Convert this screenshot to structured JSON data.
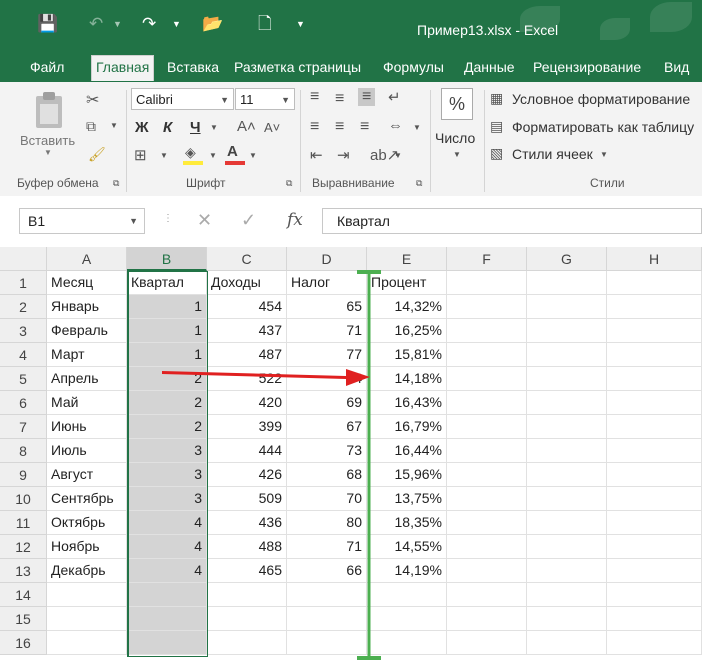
{
  "window": {
    "title": "Пример13.xlsx - Excel",
    "theme_color": "#217346"
  },
  "ribbon_tabs": [
    "Файл",
    "Главная",
    "Вставка",
    "Разметка страницы",
    "Формулы",
    "Данные",
    "Рецензирование",
    "Вид"
  ],
  "ribbon": {
    "clipboard": {
      "paste_label": "Вставить",
      "group_label": "Буфер обмена"
    },
    "font": {
      "font_name": "Calibri",
      "font_size": "11",
      "bold": "Ж",
      "italic": "К",
      "underline": "Ч",
      "group_label": "Шрифт"
    },
    "alignment": {
      "group_label": "Выравнивание"
    },
    "number": {
      "percent_symbol": "%",
      "label": "Число"
    },
    "styles": {
      "items": [
        "Условное форматирование",
        "Форматировать как таблицу",
        "Стили ячеек"
      ],
      "group_label": "Стили"
    }
  },
  "formula_bar": {
    "name_box": "B1",
    "fx_label": "fx",
    "content": "Квартал"
  },
  "sheet": {
    "columns": [
      "A",
      "B",
      "C",
      "D",
      "E",
      "F",
      "G",
      "H"
    ],
    "selected_column": "B",
    "row_numbers": [
      "1",
      "2",
      "3",
      "4",
      "5",
      "6",
      "7",
      "8",
      "9",
      "10",
      "11",
      "12",
      "13",
      "14",
      "15",
      "16"
    ],
    "headers": [
      "Месяц",
      "Квартал",
      "Доходы",
      "Налог",
      "Процент"
    ],
    "rows": [
      [
        "Январь",
        "1",
        "454",
        "65",
        "14,32%"
      ],
      [
        "Февраль",
        "1",
        "437",
        "71",
        "16,25%"
      ],
      [
        "Март",
        "1",
        "487",
        "77",
        "15,81%"
      ],
      [
        "Апрель",
        "2",
        "522",
        "74",
        "14,18%"
      ],
      [
        "Май",
        "2",
        "420",
        "69",
        "16,43%"
      ],
      [
        "Июнь",
        "2",
        "399",
        "67",
        "16,79%"
      ],
      [
        "Июль",
        "3",
        "444",
        "73",
        "16,44%"
      ],
      [
        "Август",
        "3",
        "426",
        "68",
        "15,96%"
      ],
      [
        "Сентябрь",
        "3",
        "509",
        "70",
        "13,75%"
      ],
      [
        "Октябрь",
        "4",
        "436",
        "80",
        "18,35%"
      ],
      [
        "Ноябрь",
        "4",
        "488",
        "71",
        "14,55%"
      ],
      [
        "Декабрь",
        "4",
        "465",
        "66",
        "14,19%"
      ]
    ]
  },
  "annotation": {
    "arrow_color": "#e02020",
    "marker_color": "#4caf50"
  }
}
